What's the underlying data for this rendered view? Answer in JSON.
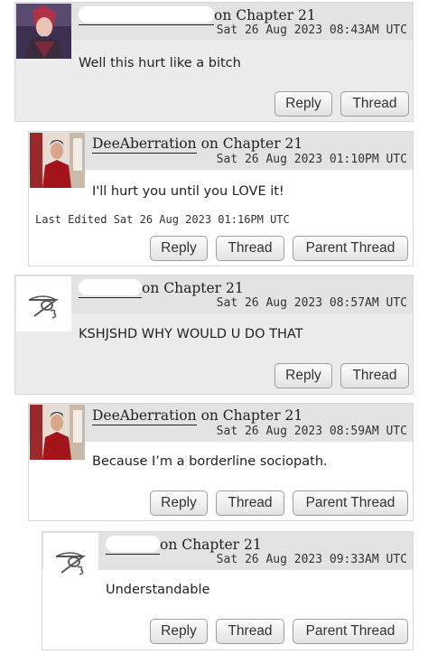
{
  "comments": [
    {
      "username": "",
      "chapter_text": "on Chapter 21",
      "date": "Sat 26 Aug 2023 08:43AM UTC",
      "text": "Well this hurt like a bitch",
      "buttons": {
        "reply": "Reply",
        "thread": "Thread"
      }
    },
    {
      "username": "DeeAberration",
      "chapter_text": "on Chapter 21",
      "date": "Sat 26 Aug 2023 01:10PM UTC",
      "text": "I'll hurt you until you LOVE it!",
      "edited": "Last Edited Sat 26 Aug 2023 01:16PM UTC",
      "buttons": {
        "reply": "Reply",
        "thread": "Thread",
        "parent": "Parent Thread"
      }
    },
    {
      "username": "",
      "chapter_text": "on Chapter 21",
      "date": "Sat 26 Aug 2023 08:57AM UTC",
      "text": "KSHJSHD WHY WOULD U DO THAT",
      "buttons": {
        "reply": "Reply",
        "thread": "Thread"
      }
    },
    {
      "username": "DeeAberration",
      "chapter_text": "on Chapter 21",
      "date": "Sat 26 Aug 2023 08:59AM UTC",
      "text": "Because I’m a borderline sociopath.",
      "buttons": {
        "reply": "Reply",
        "thread": "Thread",
        "parent": "Parent Thread"
      }
    },
    {
      "username": "",
      "chapter_text": "on Chapter 21",
      "date": "Sat 26 Aug 2023 09:33AM UTC",
      "text": "Understandable",
      "buttons": {
        "reply": "Reply",
        "thread": "Thread",
        "parent": "Parent Thread"
      }
    }
  ]
}
